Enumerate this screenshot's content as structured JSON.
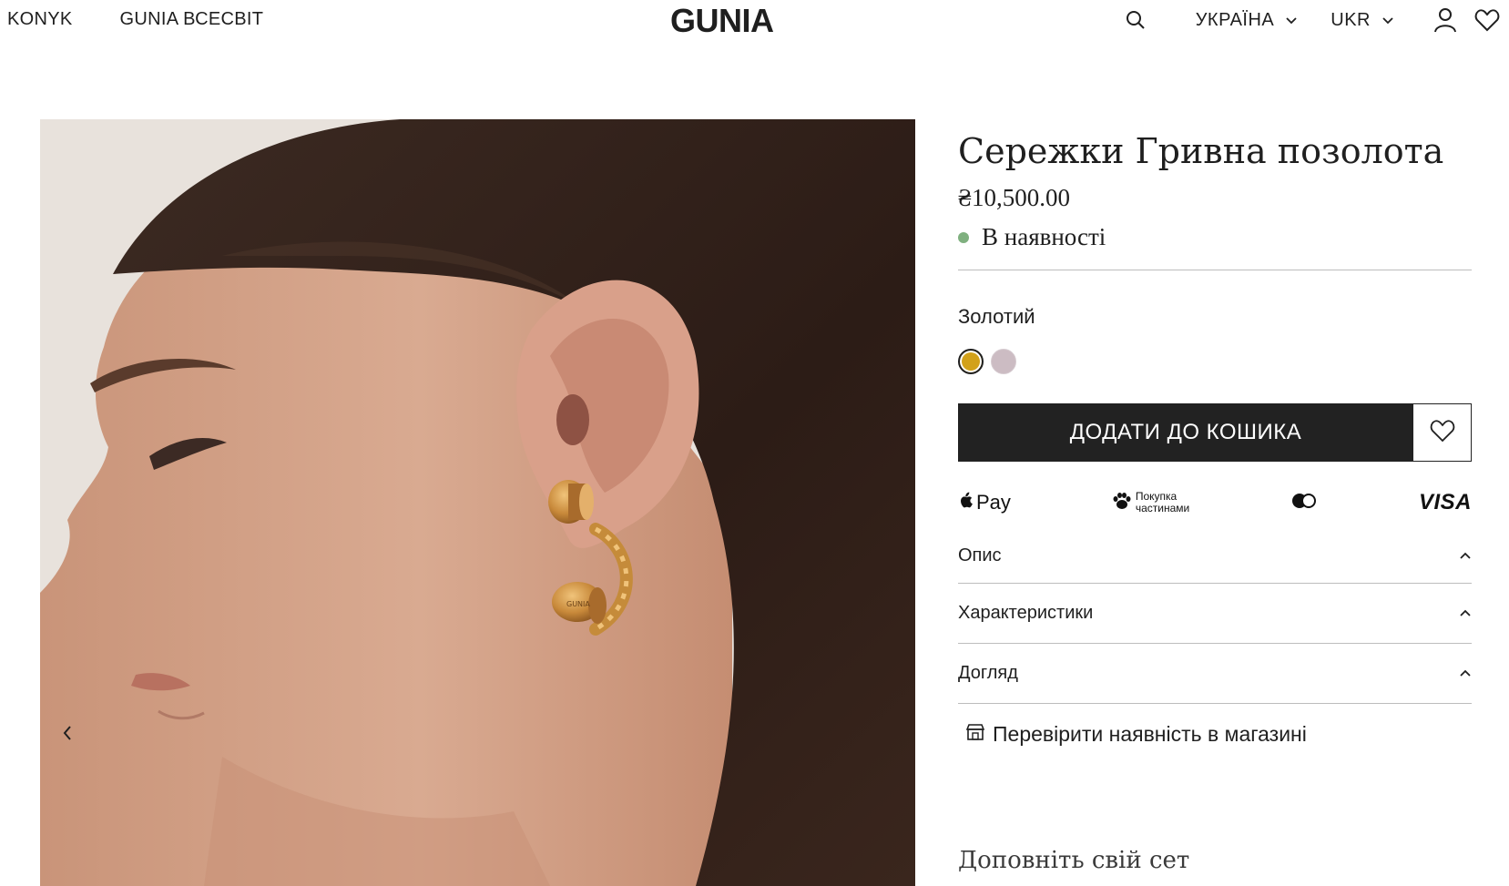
{
  "header": {
    "nav": [
      "KONYK",
      "GUNIA ВСЕСВІТ"
    ],
    "logo": "GUNIA",
    "country": "УКРАЇНА",
    "language": "UKR",
    "icons": [
      "search-icon",
      "chevron-down-icon",
      "user-icon",
      "heart-icon"
    ]
  },
  "product": {
    "title": "Сережки Гривна позолота",
    "price": "₴10,500.00",
    "stock": "В наявності",
    "stock_color": "#7fb07f",
    "color_label": "Золотий",
    "swatches": [
      {
        "name": "gold",
        "color": "#d2a11a",
        "selected": true
      },
      {
        "name": "rose",
        "color": "#ccbcc3",
        "selected": false
      }
    ],
    "add_to_cart": "ДОДАТИ ДО КОШИКА",
    "payments": {
      "apple_pay": "Pay",
      "parts_line1": "Покупка",
      "parts_line2": "частинами",
      "visa": "VISA"
    },
    "accordion": [
      "Опис",
      "Характеристики",
      "Догляд"
    ],
    "store_check": "Перевірити наявність в магазині",
    "complete_set": "Доповніть свій сет"
  },
  "image_caption": {
    "engraving": "GUNIA"
  }
}
